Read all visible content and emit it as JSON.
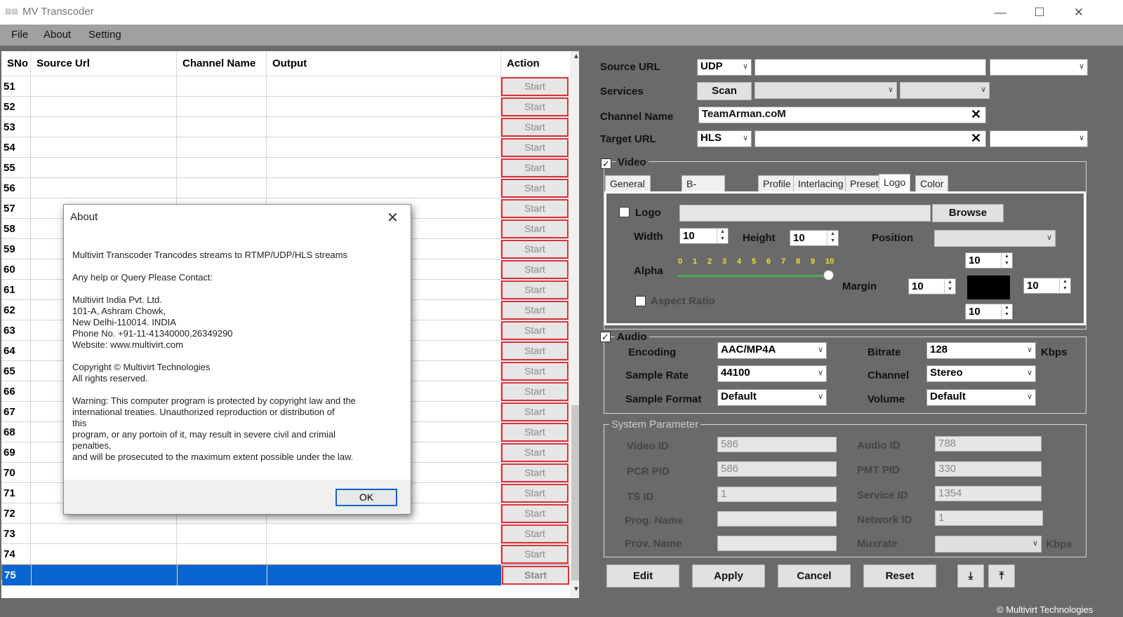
{
  "window": {
    "title": "MV Transcoder",
    "minimize": "—",
    "maximize": "☐",
    "close": "✕",
    "app_icon": "app-logo-icon"
  },
  "menu": [
    "File",
    "About",
    "Setting"
  ],
  "grid": {
    "columns": [
      "SNo",
      "Source Url",
      "Channel Name",
      "Output",
      "Action"
    ],
    "rows": [
      "51",
      "52",
      "53",
      "54",
      "55",
      "56",
      "57",
      "58",
      "59",
      "60",
      "61",
      "62",
      "63",
      "64",
      "65",
      "66",
      "67",
      "68",
      "69",
      "70",
      "71",
      "72",
      "73",
      "74",
      "75"
    ],
    "action_label": "Start",
    "selected_row": "75"
  },
  "about_dialog": {
    "title": "About",
    "line1": "Multivirt Transcoder Trancodes streams to RTMP/UDP/HLS streams",
    "line2": "Any help or Query Please Contact:",
    "address": [
      "Multivirt India Pvt. Ltd.",
      "101-A, Ashram Chowk,",
      "New Delhi-110014. INDIA",
      "Phone No. +91-11-41340000,26349290",
      "Website: www.multivirt.com"
    ],
    "copyright": [
      "Copyright © Multivirt Technologies",
      "All rights reserved."
    ],
    "warning": [
      "Warning: This computer program is protected by copyright law and the",
      "international treaties. Unauthorized reproduction or distribution of",
      "this",
      "program, or any portoin of it, may result in severe civil and crimial",
      "penalties,",
      "and will be prosecuted to the maximum extent possible under the law."
    ],
    "ok": "OK"
  },
  "form": {
    "source_url_label": "Source URL",
    "source_proto": "UDP",
    "source_url": "",
    "source_extra": "",
    "services_label": "Services",
    "scan": "Scan",
    "channel_name_label": "Channel Name",
    "channel_name": "TeamArman.coM",
    "target_url_label": "Target URL",
    "target_proto": "HLS",
    "target_url": "",
    "video_label": "Video",
    "tabs": [
      "General Settings",
      "B-Frame settings",
      "Profile",
      "Interlacing",
      "Preset",
      "Logo",
      "Color"
    ],
    "active_tab": "Logo",
    "logo_label": "Logo",
    "logo_path": "",
    "browse": "Browse",
    "width_label": "Width",
    "width": "10",
    "height_label": "Height",
    "height": "10",
    "position_label": "Position",
    "position": "",
    "alpha_label": "Alpha",
    "alpha_ticks": [
      "0",
      "1",
      "2",
      "3",
      "4",
      "5",
      "6",
      "7",
      "8",
      "9",
      "10"
    ],
    "alpha_value": 10,
    "aspect_ratio_label": "Aspect Ratio",
    "margin_label": "Margin",
    "margin_top": "10",
    "margin_left": "10",
    "margin_right": "10",
    "margin_bottom": "10",
    "margin_color": "#000000",
    "audio_label": "Audio",
    "encoding_label": "Encoding",
    "encoding": "AAC/MP4A",
    "bitrate_label": "Bitrate",
    "bitrate": "128",
    "kbps": "Kbps",
    "sample_rate_label": "Sample Rate",
    "sample_rate": "44100",
    "channel_label": "Channel",
    "channel": "Stereo",
    "sample_format_label": "Sample Format",
    "sample_format": "Default",
    "volume_label": "Volume",
    "volume": "Default",
    "sys_label": "System Parameter",
    "video_id_label": "Video ID",
    "video_id": "586",
    "audio_id_label": "Audio ID",
    "audio_id": "788",
    "pcr_pid_label": "PCR PID",
    "pcr_pid": "586",
    "pmt_pid_label": "PMT PID",
    "pmt_pid": "330",
    "ts_id_label": "TS ID",
    "ts_id": "1",
    "service_id_label": "Service ID",
    "service_id": "1354",
    "prog_name_label": "Prog. Name",
    "prog_name": "",
    "network_id_label": "Network ID",
    "network_id": "1",
    "prov_name_label": "Prov. Name",
    "prov_name": "",
    "muxrate_label": "Muxrate",
    "muxrate": "",
    "edit": "Edit",
    "apply": "Apply",
    "cancel": "Cancel",
    "reset": "Reset",
    "footer": "© Multivirt Technologies"
  }
}
